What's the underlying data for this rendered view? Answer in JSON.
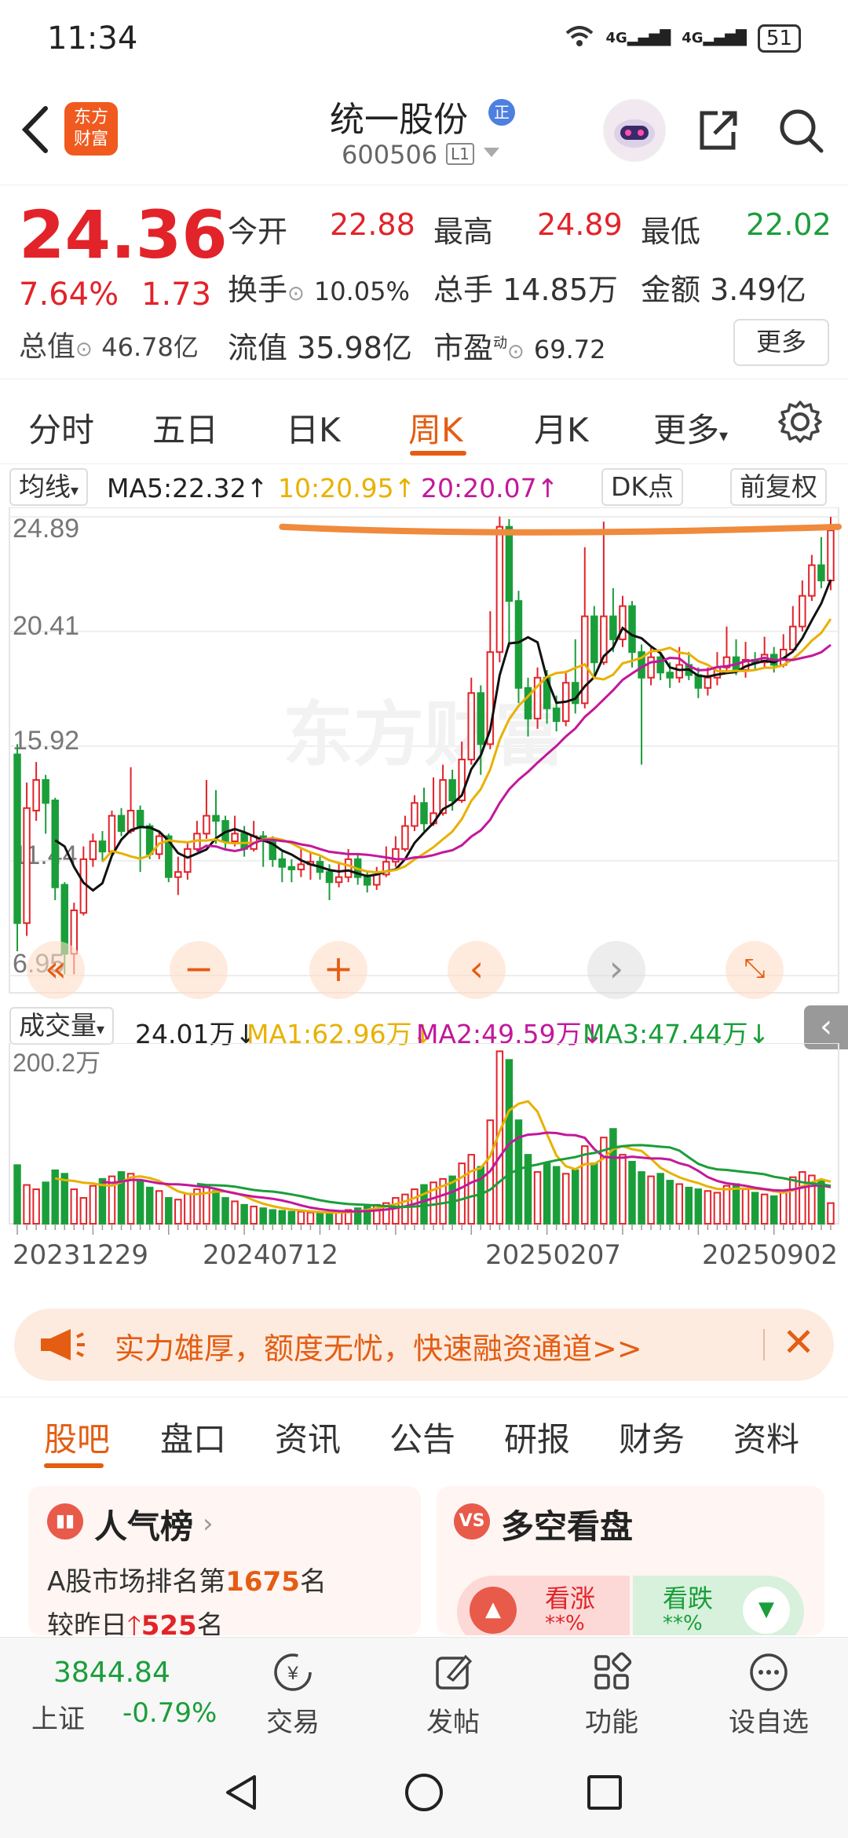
{
  "status_bar": {
    "time": "11:34",
    "network1": "4G",
    "network2": "4G",
    "battery": "51"
  },
  "header": {
    "back_icon": "chevron-left-icon",
    "logo_text": [
      "东方",
      "财富"
    ],
    "stock_name": "统一股份",
    "badge": "正",
    "stock_code": "600506",
    "level": "L1"
  },
  "quote": {
    "price": "24.36",
    "change_pct": "7.64%",
    "change_amt": "1.73",
    "total_value_label": "总值",
    "total_value": "46.78亿",
    "open_label": "今开",
    "open": "22.88",
    "high_label": "最高",
    "high": "24.89",
    "low_label": "最低",
    "low": "22.02",
    "turnover_label": "换手",
    "turnover": "10.05%",
    "volume_label": "总手",
    "volume": "14.85万",
    "amount_label": "金额",
    "amount": "3.49亿",
    "float_label": "流值",
    "float_value": "35.98亿",
    "pe_label": "市盈",
    "pe_sup": "动",
    "pe": "69.72",
    "more_button": "更多",
    "colors": {
      "up": "#e2232a",
      "down": "#1a9e3a"
    }
  },
  "kline_tabs": {
    "items": [
      "分时",
      "五日",
      "日K",
      "周K",
      "月K",
      "更多"
    ],
    "active": "周K"
  },
  "ma_bar": {
    "selector": "均线",
    "ma5": "MA5:22.32↑",
    "ma10": "10:20.95↑",
    "ma20": "20:20.07↑",
    "dk_button": "DK点",
    "adjust_button": "前复权"
  },
  "price_chart": {
    "y_labels": [
      "24.89",
      "20.41",
      "15.92",
      "11.44",
      "6.95"
    ],
    "watermark": "东方财富"
  },
  "volume_bar": {
    "selector": "成交量",
    "vol": "24.01万↓",
    "ma1": "MA1:62.96万↓",
    "ma2": "MA2:49.59万↓",
    "ma3": "MA3:47.44万↓",
    "y_label": "200.2万"
  },
  "dates": [
    "20231229",
    "20240712",
    "20250207",
    "20250902"
  ],
  "banner": {
    "text": "实力雄厚，额度无忧，快速融资通道>>"
  },
  "content_tabs": {
    "items": [
      "股吧",
      "盘口",
      "资讯",
      "公告",
      "研报",
      "财务",
      "资料"
    ],
    "active": "股吧"
  },
  "popularity_card": {
    "title": "人气榜",
    "line1_prefix": "A股市场排名第",
    "rank": "1675",
    "line1_suffix": "名",
    "line2_prefix": "较昨日",
    "delta": "525",
    "line2_suffix": "名"
  },
  "sentiment_card": {
    "title": "多空看盘",
    "bull_label": "看涨",
    "bull_value": "**%",
    "bear_label": "看跌",
    "bear_value": "**%"
  },
  "bottom_nav": {
    "index_value": "3844.84",
    "index_name": "上证",
    "index_change": "-0.79%",
    "items": [
      "交易",
      "发帖",
      "功能",
      "设自选"
    ]
  },
  "chart_data": {
    "type": "candlestick",
    "title": "",
    "price_range": [
      6.95,
      24.89
    ],
    "y_ticks": [
      24.89,
      20.41,
      15.92,
      11.44,
      6.95
    ],
    "x_tick_labels": [
      "20231229",
      "20240712",
      "20250207",
      "20250902"
    ],
    "period": "weekly",
    "candles": [
      [
        15.6,
        9.0,
        16.0,
        7.9
      ],
      [
        9.0,
        13.5,
        14.5,
        8.5
      ],
      [
        13.4,
        14.6,
        15.3,
        13.0
      ],
      [
        14.6,
        13.7,
        14.8,
        12.5
      ],
      [
        13.8,
        10.4,
        13.9,
        9.9
      ],
      [
        10.5,
        7.8,
        10.6,
        7.0
      ],
      [
        7.8,
        9.5,
        9.8,
        7.0
      ],
      [
        9.4,
        11.5,
        12.0,
        9.3
      ],
      [
        11.5,
        12.2,
        12.5,
        11.2
      ],
      [
        12.2,
        11.8,
        12.6,
        11.4
      ],
      [
        11.8,
        13.2,
        13.4,
        11.7
      ],
      [
        13.2,
        12.6,
        13.5,
        12.4
      ],
      [
        12.6,
        13.4,
        15.1,
        12.5
      ],
      [
        13.4,
        12.8,
        13.6,
        11.0
      ],
      [
        12.8,
        11.7,
        12.9,
        11.5
      ],
      [
        11.7,
        12.4,
        12.6,
        11.5
      ],
      [
        12.4,
        10.8,
        12.5,
        10.6
      ],
      [
        10.8,
        11.0,
        11.6,
        10.1
      ],
      [
        11.0,
        11.9,
        12.2,
        10.7
      ],
      [
        11.9,
        12.5,
        13.0,
        11.8
      ],
      [
        12.5,
        13.2,
        14.6,
        12.3
      ],
      [
        13.2,
        13.0,
        14.2,
        12.1
      ],
      [
        13.0,
        12.2,
        13.2,
        11.9
      ],
      [
        12.2,
        12.5,
        13.2,
        12.0
      ],
      [
        12.5,
        11.9,
        12.8,
        11.6
      ],
      [
        11.9,
        12.4,
        13.0,
        11.8
      ],
      [
        12.4,
        12.2,
        12.6,
        11.2
      ],
      [
        12.2,
        11.5,
        12.4,
        11.2
      ],
      [
        11.5,
        11.2,
        11.8,
        10.6
      ],
      [
        11.2,
        11.1,
        11.5,
        10.6
      ],
      [
        11.1,
        11.3,
        11.9,
        10.8
      ],
      [
        11.3,
        11.4,
        11.8,
        10.7
      ],
      [
        11.4,
        11.0,
        11.6,
        10.7
      ],
      [
        11.0,
        10.6,
        11.3,
        9.9
      ],
      [
        10.6,
        10.8,
        11.4,
        10.4
      ],
      [
        10.8,
        11.5,
        11.9,
        10.6
      ],
      [
        11.5,
        10.8,
        11.7,
        10.5
      ],
      [
        10.8,
        10.5,
        11.0,
        10.2
      ],
      [
        10.5,
        10.9,
        11.2,
        10.3
      ],
      [
        10.9,
        11.4,
        12.0,
        10.8
      ],
      [
        11.4,
        11.9,
        12.4,
        11.2
      ],
      [
        11.9,
        12.8,
        13.2,
        11.8
      ],
      [
        12.8,
        13.7,
        14.0,
        12.6
      ],
      [
        13.7,
        12.9,
        14.3,
        12.6
      ],
      [
        12.9,
        13.3,
        14.7,
        12.8
      ],
      [
        13.3,
        14.6,
        15.2,
        13.2
      ],
      [
        14.6,
        13.8,
        15.0,
        13.4
      ],
      [
        13.8,
        15.4,
        16.1,
        13.7
      ],
      [
        15.4,
        18.0,
        18.6,
        15.2
      ],
      [
        18.0,
        16.0,
        18.3,
        14.8
      ],
      [
        16.0,
        19.6,
        21.2,
        15.8
      ],
      [
        19.6,
        24.5,
        24.9,
        19.2
      ],
      [
        24.5,
        21.6,
        24.8,
        19.8
      ],
      [
        21.6,
        18.2,
        22.0,
        17.6
      ],
      [
        18.2,
        17.0,
        18.6,
        16.3
      ],
      [
        17.0,
        18.6,
        19.0,
        16.6
      ],
      [
        18.6,
        17.4,
        18.9,
        16.8
      ],
      [
        17.4,
        16.9,
        17.9,
        16.5
      ],
      [
        16.9,
        18.4,
        18.8,
        16.7
      ],
      [
        18.4,
        17.6,
        20.1,
        17.2
      ],
      [
        17.6,
        21.0,
        23.7,
        17.4
      ],
      [
        21.0,
        19.2,
        21.4,
        18.6
      ],
      [
        19.2,
        21.0,
        24.7,
        19.1
      ],
      [
        21.0,
        20.1,
        22.1,
        19.6
      ],
      [
        20.1,
        21.4,
        21.8,
        19.8
      ],
      [
        21.4,
        19.6,
        21.6,
        19.0
      ],
      [
        19.6,
        18.6,
        19.9,
        15.2
      ],
      [
        18.6,
        19.4,
        19.8,
        18.3
      ],
      [
        19.4,
        18.8,
        19.6,
        18.5
      ],
      [
        18.8,
        18.6,
        19.2,
        18.2
      ],
      [
        18.6,
        19.1,
        19.8,
        18.4
      ],
      [
        19.1,
        18.7,
        19.6,
        18.5
      ],
      [
        18.7,
        18.2,
        19.0,
        17.8
      ],
      [
        18.2,
        18.6,
        19.0,
        17.9
      ],
      [
        18.6,
        19.0,
        19.6,
        18.3
      ],
      [
        19.0,
        19.4,
        20.6,
        18.8
      ],
      [
        19.4,
        18.9,
        20.1,
        18.7
      ],
      [
        18.9,
        19.3,
        20.0,
        18.6
      ],
      [
        19.3,
        19.2,
        19.6,
        18.9
      ],
      [
        19.2,
        19.5,
        20.2,
        19.0
      ],
      [
        19.5,
        19.1,
        19.8,
        18.8
      ],
      [
        19.1,
        19.7,
        20.3,
        19.0
      ],
      [
        19.7,
        20.6,
        21.4,
        19.6
      ],
      [
        20.6,
        21.8,
        22.4,
        20.4
      ],
      [
        21.8,
        23.0,
        23.4,
        21.6
      ],
      [
        23.0,
        22.4,
        24.1,
        22.1
      ],
      [
        22.4,
        24.36,
        24.89,
        22.02
      ]
    ],
    "volumes": [
      68,
      45,
      40,
      48,
      62,
      58,
      40,
      30,
      44,
      52,
      55,
      60,
      58,
      50,
      42,
      38,
      30,
      28,
      35,
      40,
      45,
      38,
      30,
      26,
      22,
      20,
      18,
      16,
      15,
      14,
      14,
      13,
      12,
      12,
      14,
      16,
      18,
      20,
      22,
      24,
      30,
      34,
      40,
      45,
      48,
      52,
      55,
      70,
      80,
      66,
      120,
      200,
      190,
      120,
      80,
      60,
      70,
      66,
      58,
      62,
      90,
      70,
      100,
      110,
      80,
      72,
      60,
      55,
      58,
      50,
      46,
      42,
      40,
      38,
      36,
      44,
      46,
      40,
      36,
      34,
      32,
      38,
      54,
      60,
      56,
      50,
      24
    ],
    "horizontal_line_level": 24.5
  }
}
